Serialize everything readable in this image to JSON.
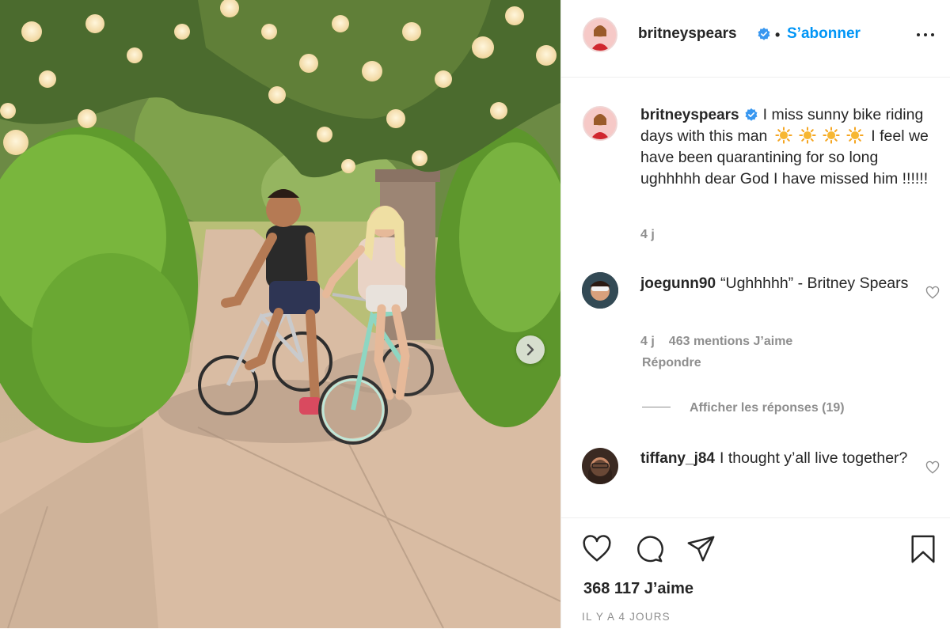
{
  "post": {
    "owner": {
      "username": "britneyspears",
      "verified": true,
      "follow_label": "S’abonner",
      "separator": "•"
    },
    "caption": {
      "username": "britneyspears",
      "text_before": "I miss sunny bike riding days with this man",
      "emoji_count": 4,
      "text_after": "I feel we have been quarantining for so long ughhhhh dear God I have missed him !!!!!!",
      "age": "4 j"
    },
    "comments": [
      {
        "username": "joegunn90",
        "text": "“Ughhhhh” - Britney Spears",
        "age": "4 j",
        "likes": "463 mentions J’aime",
        "reply_label": "Répondre",
        "view_replies": "Afficher les réponses (19)"
      },
      {
        "username": "tiffany_j84",
        "text": "I thought y’all live together?"
      }
    ],
    "likes_total": "368 117 J’aime",
    "posted": "IL Y A 4 JOURS"
  },
  "icons": {
    "verified": "verified-badge-icon",
    "more": "more-options-icon",
    "like": "heart-icon",
    "comment": "comment-icon",
    "share": "paper-plane-icon",
    "save": "bookmark-icon",
    "next": "chevron-right-icon",
    "emoji": "sun-emoji-icon"
  },
  "colors": {
    "link_blue": "#0095f6",
    "verified_blue": "#3897f0",
    "text": "#262626",
    "secondary": "#8e8e8e",
    "border": "#efefef"
  }
}
